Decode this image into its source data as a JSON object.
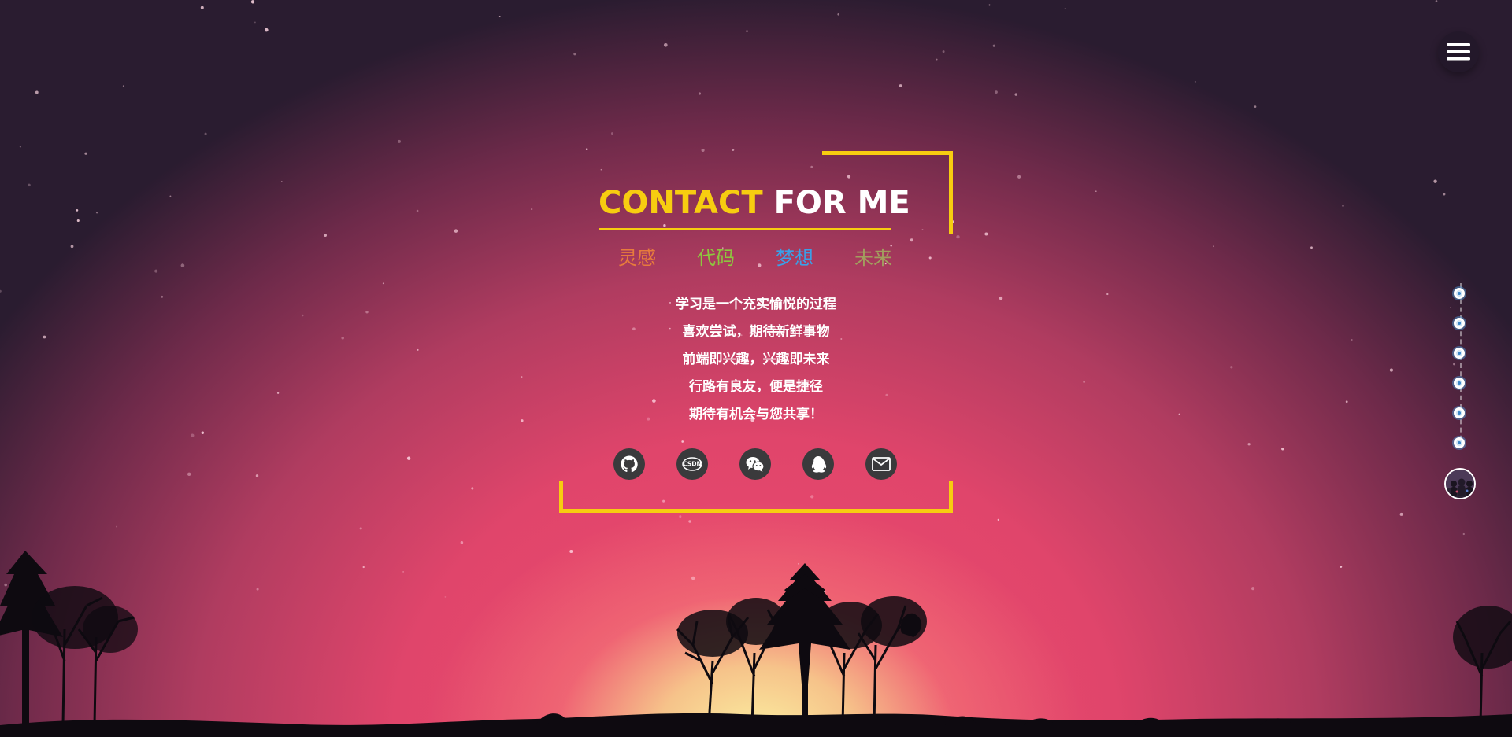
{
  "title": {
    "highlight": "CONTACT",
    "rest": "FOR ME"
  },
  "keywords": [
    {
      "label": "灵感",
      "color": "#e77b3c"
    },
    {
      "label": "代码",
      "color": "#8dc63f"
    },
    {
      "label": "梦想",
      "color": "#3aa0e8"
    },
    {
      "label": "未来",
      "color": "#a29e5e"
    }
  ],
  "lines": [
    "学习是一个充实愉悦的过程",
    "喜欢尝试，期待新鲜事物",
    "前端即兴趣，兴趣即未来",
    "行路有良友，便是捷径",
    "期待有机会与您共享！"
  ],
  "socials": [
    {
      "name": "github",
      "icon": "github-icon"
    },
    {
      "name": "csdn",
      "icon": "csdn-icon",
      "text": "CSDN"
    },
    {
      "name": "wechat",
      "icon": "wechat-icon"
    },
    {
      "name": "qq",
      "icon": "qq-icon"
    },
    {
      "name": "email",
      "icon": "mail-icon"
    }
  ],
  "navigation": {
    "menu_icon": "hamburger-menu-icon",
    "timeline_dots": 6,
    "avatar": "avatar-image"
  },
  "colors": {
    "accent": "#f7cd10",
    "text": "#ffffff",
    "social_bg": "#3a3a3c"
  }
}
